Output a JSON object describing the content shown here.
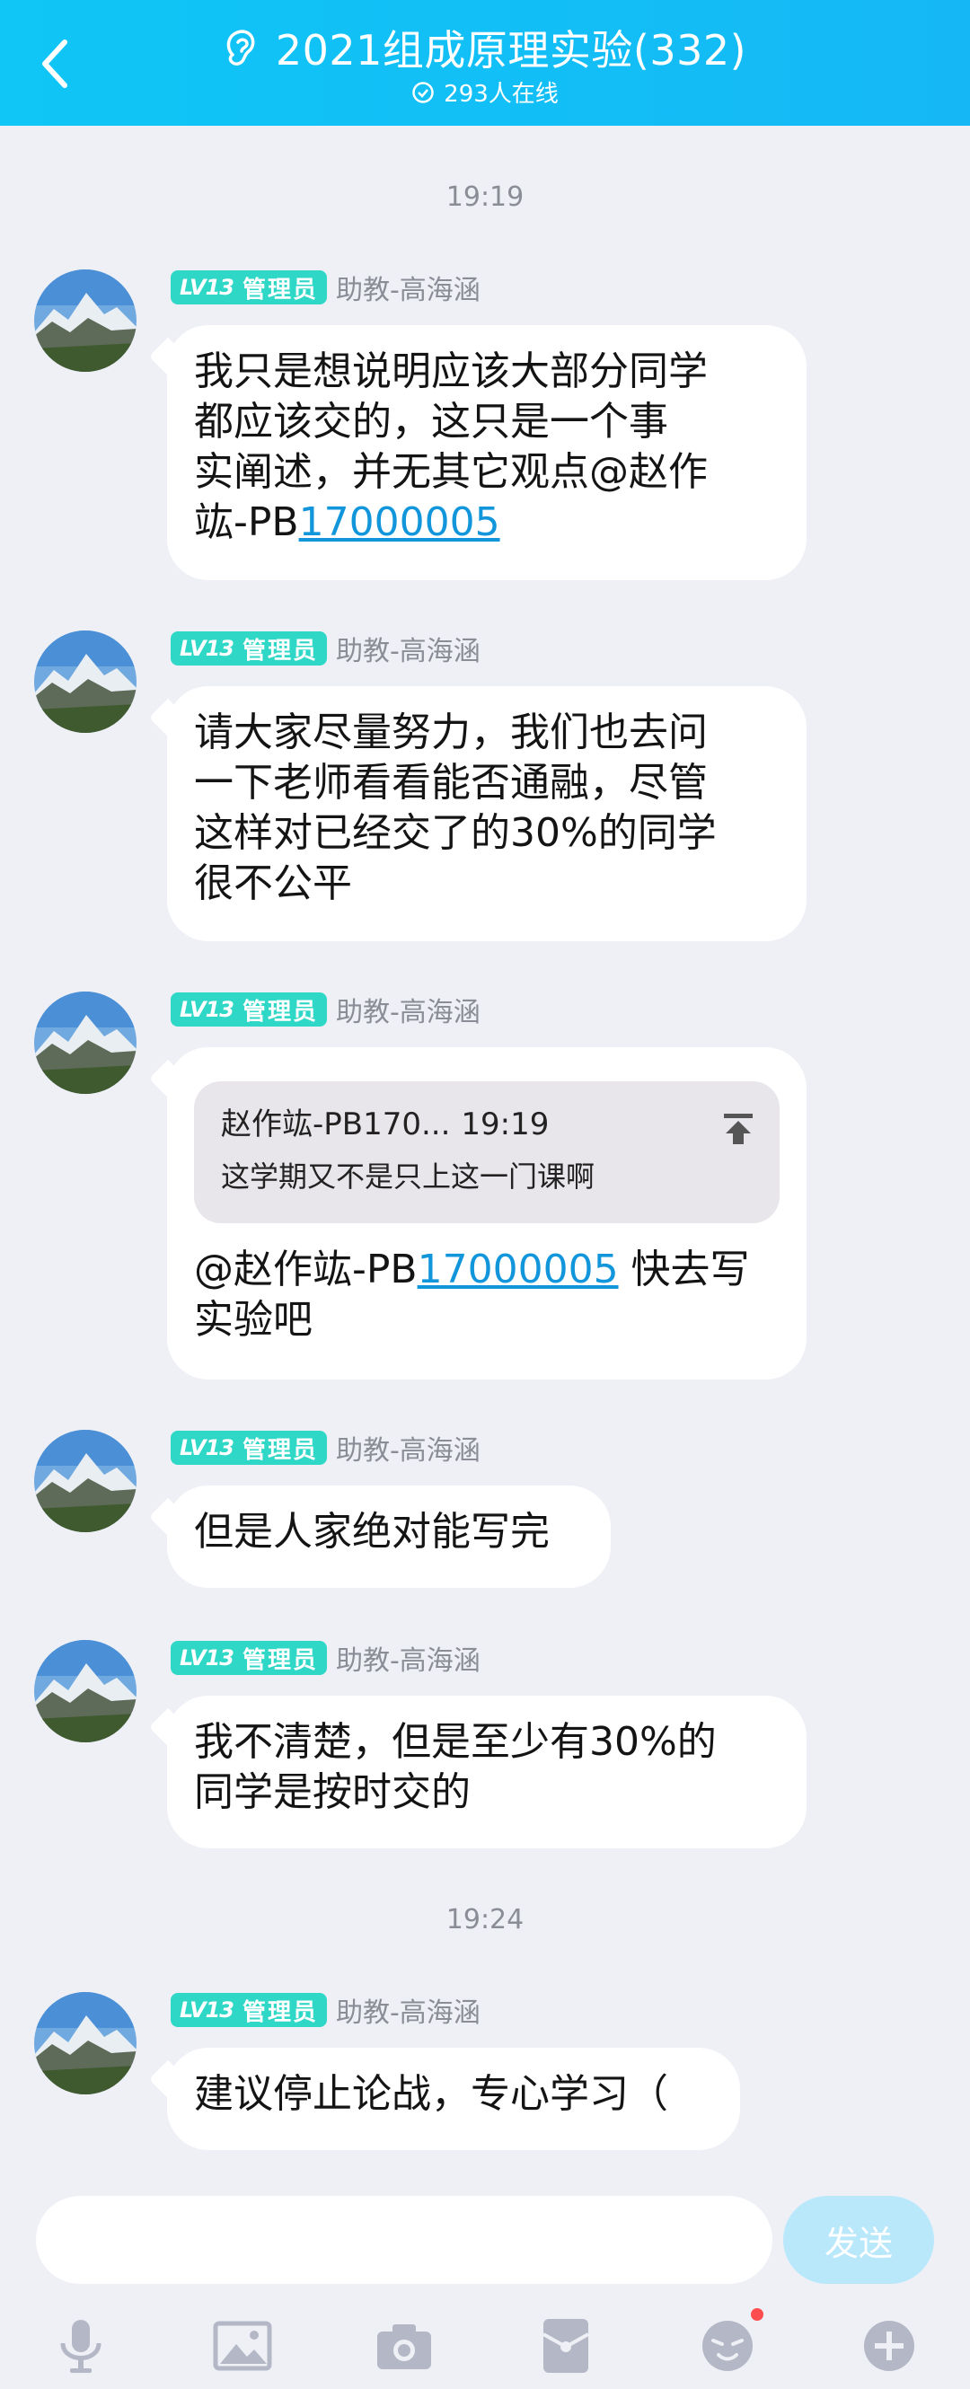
{
  "header": {
    "title": "2021组成原理实验(332)",
    "online": "293人在线"
  },
  "times": [
    "19:19",
    "19:24"
  ],
  "badge": {
    "level": "LV13",
    "role": "管理员"
  },
  "sender": "助教-高海涵",
  "messages": [
    {
      "text_a": "我只是想说明应该大部分同学",
      "text_b": "都应该交的，这只是一个事",
      "text_c": "实阐述，并无其它观点@赵作",
      "text_d": "竑-PB",
      "link": "17000005"
    },
    {
      "line1": "请大家尽量努力，我们也去问",
      "line2": "一下老师看看能否通融，尽管",
      "line3": "这样对已经交了的30%的同学",
      "line4": "很不公平"
    },
    {
      "quote_name": "赵作竑-PB170...",
      "quote_time": "19:19",
      "quote_text": "这学期又不是只上这一门课啊",
      "mention": "@赵作竑-PB",
      "link": "17000005",
      "after": " 快去写",
      "line2": "实验吧"
    },
    {
      "line1": "但是人家绝对能写完"
    },
    {
      "line1": "我不清楚，但是至少有30%的",
      "line2": "同学是按时交的"
    },
    {
      "line1": "建议停止论战，专心学习（"
    }
  ],
  "input": {
    "placeholder": "",
    "send_label": "发送"
  },
  "toolbar": [
    "mic-icon",
    "image-icon",
    "camera-icon",
    "red-packet-icon",
    "emoji-icon",
    "plus-icon"
  ],
  "colors": {
    "header": "#13bff6",
    "badge": "#2fd7c6",
    "link": "#1296db",
    "send": "#b9e8fb"
  }
}
